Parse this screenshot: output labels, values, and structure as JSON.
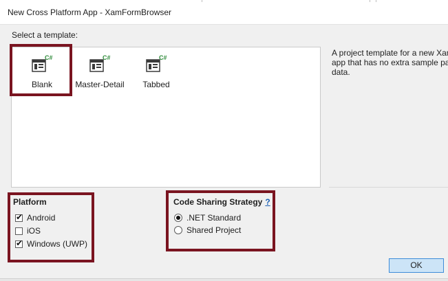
{
  "window": {
    "title": "New Cross Platform App - XamFormBrowser"
  },
  "template_section": {
    "label": "Select a template:"
  },
  "templates": [
    {
      "name": "Blank",
      "badge": "C#",
      "selected": true
    },
    {
      "name": "Master-Detail",
      "badge": "C#",
      "selected": false
    },
    {
      "name": "Tabbed",
      "badge": "C#",
      "selected": false
    }
  ],
  "description": {
    "lines": [
      "A project template for a new Xam",
      "app that has no extra sample pag",
      "data."
    ]
  },
  "platform": {
    "title": "Platform",
    "options": [
      {
        "label": "Android",
        "checked": true
      },
      {
        "label": "iOS",
        "checked": false
      },
      {
        "label": "Windows (UWP)",
        "checked": true
      }
    ]
  },
  "code_sharing": {
    "title": "Code Sharing Strategy",
    "help_link": "?",
    "options": [
      {
        "label": ".NET Standard",
        "selected": true
      },
      {
        "label": "Shared Project",
        "selected": false
      }
    ]
  },
  "footer": {
    "ok_label": "OK"
  },
  "colors": {
    "highlight": "#7a1420",
    "csharp_badge": "#2e8b3a",
    "ok_fill": "#cce4f7",
    "ok_border": "#3c8bd9",
    "link": "#1a5fb4"
  }
}
